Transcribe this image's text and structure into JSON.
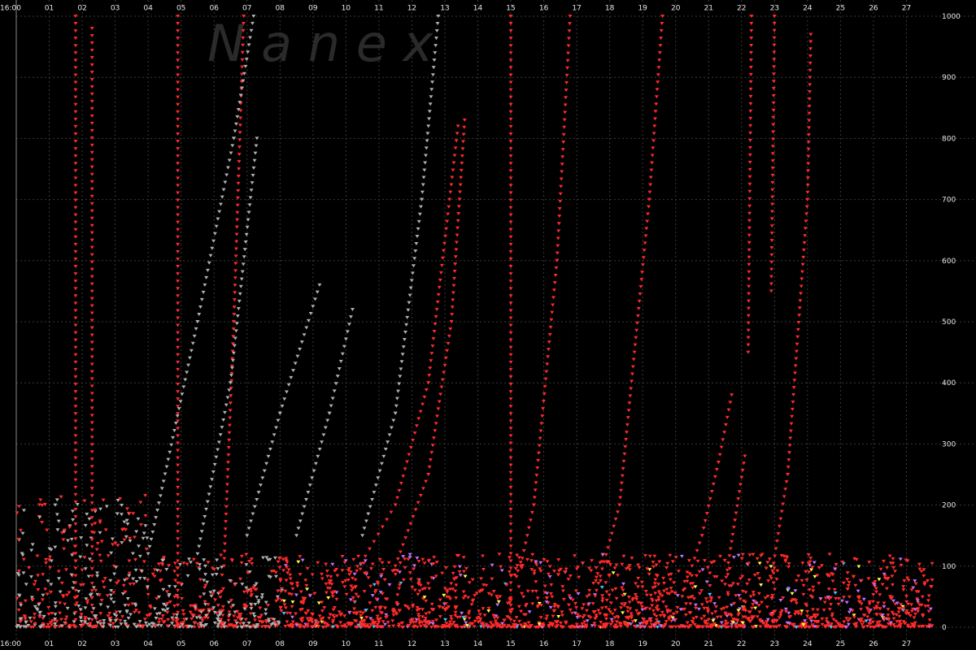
{
  "watermark": "N   a   n   e   x",
  "chart_data": {
    "type": "scatter",
    "title": "",
    "xlabel": "",
    "ylabel": "",
    "x_ticks": [
      "16:00",
      "01",
      "02",
      "03",
      "04",
      "05",
      "06",
      "07",
      "08",
      "09",
      "10",
      "11",
      "12",
      "13",
      "14",
      "15",
      "16",
      "17",
      "18",
      "19",
      "20",
      "21",
      "22",
      "23",
      "24",
      "25",
      "26",
      "27"
    ],
    "y_ticks": [
      "0",
      "100",
      "200",
      "300",
      "400",
      "500",
      "600",
      "700",
      "800",
      "900",
      "1000"
    ],
    "ylim": [
      0,
      1000
    ],
    "xlim": [
      0,
      28
    ],
    "grid": true,
    "background": "#000000",
    "grid_color": "#3a3a3a",
    "marker": "triangle-down",
    "series_colors": [
      "#ff2a2a",
      "#b0b0b0",
      "#c070ff",
      "#ffff40",
      "#40c0ff",
      "#ff9020"
    ],
    "curves": [
      {
        "color": "#ff2a2a",
        "points": [
          [
            1.8,
            0
          ],
          [
            1.8,
            1000
          ]
        ]
      },
      {
        "color": "#ff2a2a",
        "points": [
          [
            2.3,
            0
          ],
          [
            2.3,
            980
          ]
        ]
      },
      {
        "color": "#ff2a2a",
        "points": [
          [
            4.9,
            0
          ],
          [
            4.9,
            1000
          ]
        ]
      },
      {
        "color": "#ff2a2a",
        "points": [
          [
            6.3,
            100
          ],
          [
            6.6,
            500
          ],
          [
            6.9,
            1000
          ]
        ]
      },
      {
        "color": "#b0b0b0",
        "points": [
          [
            4.0,
            120
          ],
          [
            5.5,
            500
          ],
          [
            6.6,
            800
          ],
          [
            7.2,
            1000
          ]
        ]
      },
      {
        "color": "#b0b0b0",
        "points": [
          [
            5.5,
            120
          ],
          [
            6.5,
            400
          ],
          [
            7.3,
            800
          ]
        ]
      },
      {
        "color": "#b0b0b0",
        "points": [
          [
            7.0,
            150
          ],
          [
            8.0,
            350
          ],
          [
            9.2,
            560
          ]
        ]
      },
      {
        "color": "#b0b0b0",
        "points": [
          [
            8.5,
            150
          ],
          [
            9.5,
            350
          ],
          [
            10.2,
            520
          ]
        ]
      },
      {
        "color": "#b0b0b0",
        "points": [
          [
            10.5,
            150
          ],
          [
            11.5,
            350
          ],
          [
            12.3,
            700
          ],
          [
            12.8,
            1000
          ]
        ]
      },
      {
        "color": "#ff2a2a",
        "points": [
          [
            10.2,
            80
          ],
          [
            11.5,
            200
          ],
          [
            12.5,
            400
          ],
          [
            13.4,
            820
          ]
        ]
      },
      {
        "color": "#ff2a2a",
        "points": [
          [
            11.5,
            100
          ],
          [
            12.5,
            250
          ],
          [
            13.2,
            500
          ],
          [
            13.6,
            830
          ]
        ]
      },
      {
        "color": "#ff2a2a",
        "points": [
          [
            15.0,
            0
          ],
          [
            15.0,
            1000
          ]
        ]
      },
      {
        "color": "#ff2a2a",
        "points": [
          [
            15.3,
            100
          ],
          [
            15.7,
            200
          ],
          [
            16.4,
            600
          ],
          [
            16.8,
            1000
          ]
        ]
      },
      {
        "color": "#ff2a2a",
        "points": [
          [
            17.6,
            60
          ],
          [
            18.3,
            200
          ],
          [
            19.2,
            700
          ],
          [
            19.6,
            1000
          ]
        ]
      },
      {
        "color": "#ff2a2a",
        "points": [
          [
            20.2,
            50
          ],
          [
            20.8,
            150
          ],
          [
            21.3,
            270
          ],
          [
            21.7,
            380
          ]
        ]
      },
      {
        "color": "#ff2a2a",
        "points": [
          [
            21.5,
            70
          ],
          [
            22.1,
            280
          ]
        ]
      },
      {
        "color": "#ff2a2a",
        "points": [
          [
            22.2,
            450
          ],
          [
            22.3,
            1000
          ]
        ]
      },
      {
        "color": "#ff2a2a",
        "points": [
          [
            22.9,
            550
          ],
          [
            23.0,
            1000
          ]
        ]
      },
      {
        "color": "#ff2a2a",
        "points": [
          [
            22.9,
            80
          ],
          [
            23.4,
            250
          ],
          [
            24.0,
            700
          ],
          [
            24.1,
            970
          ]
        ]
      }
    ]
  }
}
